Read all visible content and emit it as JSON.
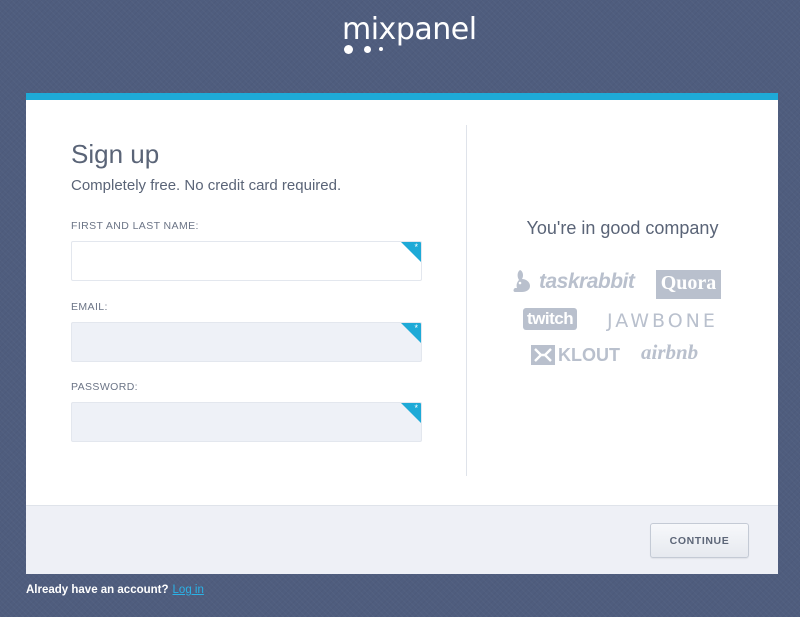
{
  "header": {
    "logo_text": "mixpanel"
  },
  "form": {
    "title": "Sign up",
    "subtitle": "Completely free. No credit card required.",
    "fields": [
      {
        "label": "FIRST AND LAST NAME:",
        "value": "",
        "placeholder": "",
        "required_mark": "*"
      },
      {
        "label": "EMAIL:",
        "value": "",
        "placeholder": "",
        "required_mark": "*"
      },
      {
        "label": "PASSWORD:",
        "value": "",
        "placeholder": "",
        "required_mark": "*"
      }
    ],
    "continue_label": "CONTINUE"
  },
  "companies": {
    "title": "You're in good company",
    "logos": [
      {
        "name": "taskrabbit",
        "icon": "rabbit-icon"
      },
      {
        "name": "Quora"
      },
      {
        "name": "twitch"
      },
      {
        "name": "JAWBONE"
      },
      {
        "name": "KLOUT",
        "icon": "klout-icon"
      },
      {
        "name": "airbnb"
      }
    ]
  },
  "footer": {
    "account_text": "Already have an account?",
    "login_link": "Log in"
  },
  "colors": {
    "accent": "#1eaad7",
    "background": "#4f5d7e",
    "logo_gray": "#b9c0cd",
    "link": "#2ab2e6"
  }
}
